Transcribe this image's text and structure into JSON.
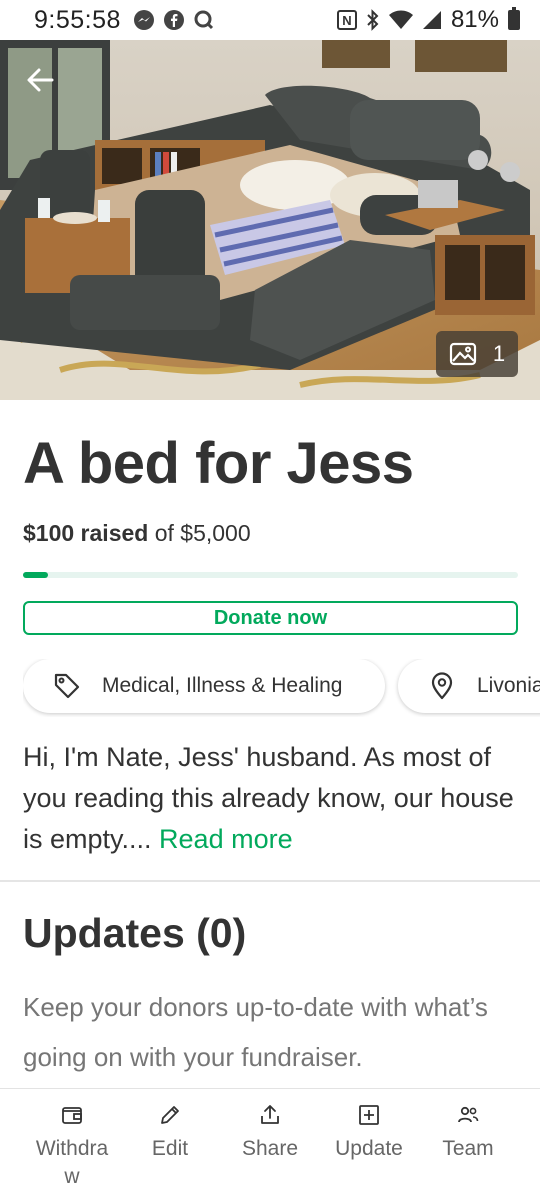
{
  "status_bar": {
    "time": "9:55:58",
    "battery": "81%",
    "left_icons": [
      "messenger-icon",
      "facebook-icon",
      "search-app-icon"
    ],
    "right_icons": [
      "nfc-icon",
      "bluetooth-icon",
      "wifi-icon",
      "signal-icon",
      "battery-icon"
    ]
  },
  "hero": {
    "photo_count": "1",
    "icons": [
      "back-arrow-icon",
      "image-gallery-icon"
    ]
  },
  "fundraiser": {
    "title": "A bed for Jess",
    "raised_amount": "$100 raised",
    "goal_text": "of $5,000",
    "progress_fraction": 0.02,
    "donate_label": "Donate now",
    "category_chip": "Medical, Illness & Healing",
    "location_chip": "Livonia",
    "story_text": "Hi, I'm Nate, Jess' husband. As most of you reading this already know, our house is empty....",
    "read_more_label": "Read more"
  },
  "updates": {
    "title": "Updates (0)",
    "description": "Keep your donors up-to-date with what’s going on with your fundraiser."
  },
  "bottom_nav": {
    "items": [
      {
        "label": "Withdraw",
        "icon": "wallet-icon"
      },
      {
        "label": "Edit",
        "icon": "pencil-icon"
      },
      {
        "label": "Share",
        "icon": "share-icon"
      },
      {
        "label": "Update",
        "icon": "plus-square-icon"
      },
      {
        "label": "Team",
        "icon": "team-icon"
      }
    ]
  },
  "colors": {
    "accent": "#02a95c",
    "text": "#333333",
    "muted": "#767676"
  }
}
